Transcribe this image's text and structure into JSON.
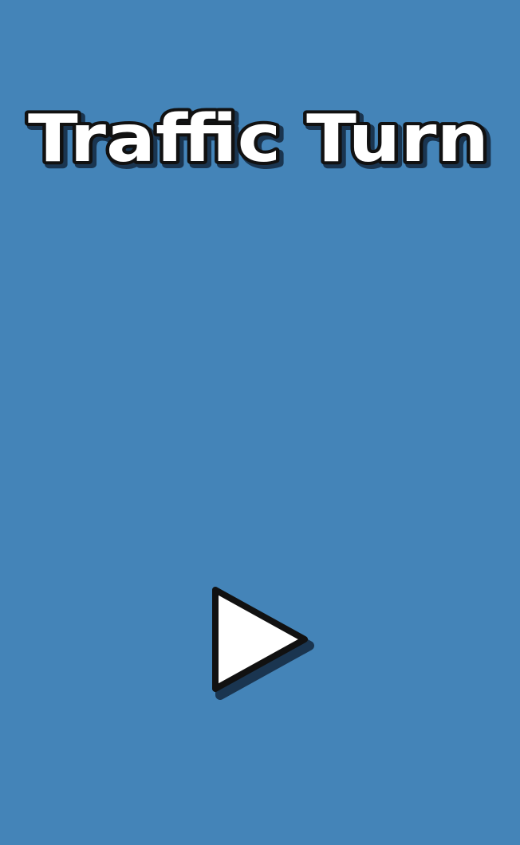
{
  "app": {
    "title": "Traffic Turn",
    "background_color": "#4484b8"
  },
  "play_button": {
    "icon": "play-icon",
    "fill_color": "#ffffff",
    "outline_color": "#111111"
  }
}
